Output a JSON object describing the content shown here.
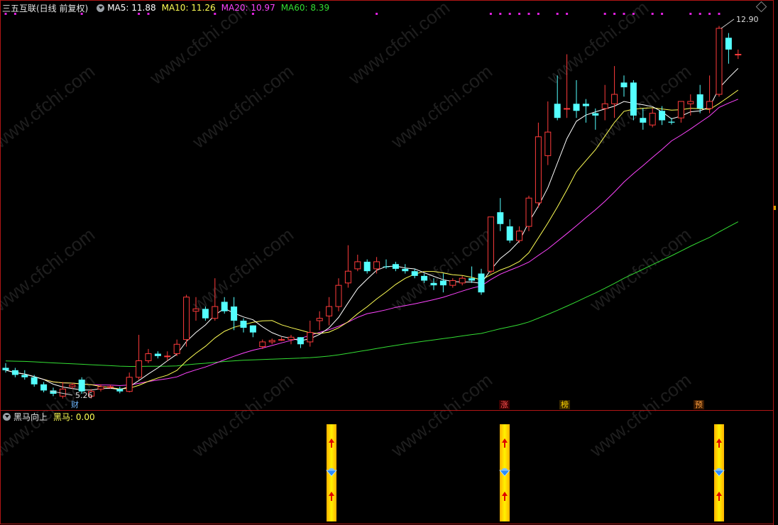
{
  "main_legend": {
    "title": "三五互联(日线 前复权)",
    "ma5": "MA5: 11.88",
    "ma10": "MA10: 11.26",
    "ma20": "MA20: 10.97",
    "ma60": "MA60: 8.39"
  },
  "sub_legend": {
    "title": "黑马向上",
    "value": "黑马: 0.00"
  },
  "labels": {
    "high": "12.90",
    "low": "5.26",
    "cai": "财",
    "zhang": "涨",
    "bang": "榜",
    "yu": "预"
  },
  "colors": {
    "bg": "#000000",
    "up": "#ff3b3b",
    "down": "#54ffff",
    "ma5": "#ffffff",
    "ma10": "#ffff55",
    "ma20": "#ff44ff",
    "ma60": "#33dd33",
    "frame": "#b01515",
    "signal": "#ffd400"
  },
  "chart_data": {
    "type": "candlestick",
    "title": "三五互联(日线 前复权)",
    "series": [
      {
        "name": "MA5",
        "last": 11.88
      },
      {
        "name": "MA10",
        "last": 11.26
      },
      {
        "name": "MA20",
        "last": 10.97
      },
      {
        "name": "MA60",
        "last": 8.39
      }
    ],
    "ylim": [
      5.0,
      13.2
    ],
    "high_mark": 12.9,
    "low_mark": 5.26,
    "candles": [
      [
        5.7,
        5.65,
        5.8,
        5.6
      ],
      [
        5.65,
        5.55,
        5.7,
        5.5
      ],
      [
        5.55,
        5.5,
        5.65,
        5.45
      ],
      [
        5.5,
        5.35,
        5.55,
        5.3
      ],
      [
        5.35,
        5.22,
        5.4,
        5.18
      ],
      [
        5.22,
        5.15,
        5.28,
        5.1
      ],
      [
        5.1,
        5.25,
        5.4,
        5.05
      ],
      [
        5.3,
        5.34,
        5.38,
        5.25
      ],
      [
        5.45,
        5.2,
        5.5,
        5.15
      ],
      [
        5.1,
        5.2,
        5.25,
        5.05
      ],
      [
        5.25,
        5.3,
        5.35,
        5.2
      ],
      [
        5.3,
        5.3,
        5.34,
        5.26
      ],
      [
        5.25,
        5.2,
        5.3,
        5.16
      ],
      [
        5.2,
        5.5,
        5.6,
        5.18
      ],
      [
        5.5,
        5.85,
        6.4,
        5.45
      ],
      [
        5.85,
        6.0,
        6.1,
        5.8
      ],
      [
        6.0,
        5.95,
        6.05,
        5.9
      ],
      [
        5.95,
        5.95,
        6.05,
        5.85
      ],
      [
        6.0,
        6.2,
        6.3,
        5.95
      ],
      [
        6.3,
        7.2,
        7.25,
        6.15
      ],
      [
        6.9,
        6.95,
        7.2,
        6.7
      ],
      [
        6.95,
        6.75,
        7.0,
        6.7
      ],
      [
        6.75,
        7.0,
        7.6,
        6.7
      ],
      [
        7.1,
        6.9,
        7.2,
        6.85
      ],
      [
        7.0,
        6.7,
        7.2,
        6.5
      ],
      [
        6.7,
        6.55,
        6.75,
        6.45
      ],
      [
        6.6,
        6.45,
        6.6,
        6.35
      ],
      [
        6.15,
        6.25,
        6.3,
        6.1
      ],
      [
        6.25,
        6.28,
        6.32,
        6.2
      ],
      [
        6.3,
        6.3,
        6.35,
        6.27
      ],
      [
        6.3,
        6.35,
        6.4,
        6.2
      ],
      [
        6.35,
        6.2,
        6.35,
        6.12
      ],
      [
        6.25,
        6.45,
        6.7,
        6.15
      ],
      [
        6.7,
        6.75,
        6.9,
        6.5
      ],
      [
        6.8,
        7.0,
        7.2,
        6.6
      ],
      [
        7.0,
        7.45,
        7.6,
        6.9
      ],
      [
        7.5,
        7.75,
        8.3,
        7.4
      ],
      [
        7.8,
        7.95,
        8.1,
        7.75
      ],
      [
        7.95,
        7.75,
        8.0,
        7.7
      ],
      [
        7.8,
        7.95,
        8.05,
        7.7
      ],
      [
        7.85,
        7.84,
        8.0,
        7.8
      ],
      [
        7.9,
        7.8,
        7.95,
        7.75
      ],
      [
        7.8,
        7.75,
        7.9,
        7.7
      ],
      [
        7.75,
        7.65,
        7.8,
        7.6
      ],
      [
        7.65,
        7.55,
        7.7,
        7.5
      ],
      [
        7.5,
        7.45,
        7.6,
        7.35
      ],
      [
        7.55,
        7.45,
        7.7,
        7.3
      ],
      [
        7.45,
        7.55,
        7.6,
        7.4
      ],
      [
        7.5,
        7.6,
        7.65,
        7.45
      ],
      [
        7.6,
        7.55,
        7.85,
        7.5
      ],
      [
        7.7,
        7.3,
        7.8,
        7.25
      ],
      [
        7.75,
        8.9,
        8.9,
        7.7
      ],
      [
        9.0,
        8.75,
        9.3,
        8.6
      ],
      [
        8.7,
        8.4,
        8.85,
        8.35
      ],
      [
        8.4,
        8.6,
        8.7,
        8.35
      ],
      [
        8.7,
        9.3,
        9.35,
        8.6
      ],
      [
        9.2,
        10.6,
        10.9,
        9.1
      ],
      [
        10.2,
        10.7,
        11.35,
        10.0
      ],
      [
        11.3,
        11.0,
        11.9,
        10.95
      ],
      [
        11.2,
        11.2,
        12.35,
        11.0
      ],
      [
        11.3,
        11.15,
        11.8,
        11.0
      ],
      [
        11.3,
        11.25,
        11.4,
        10.9
      ],
      [
        11.1,
        11.05,
        11.2,
        10.75
      ],
      [
        11.2,
        11.3,
        11.7,
        10.95
      ],
      [
        11.3,
        11.5,
        12.1,
        11.0
      ],
      [
        11.75,
        11.65,
        11.9,
        11.45
      ],
      [
        11.75,
        11.05,
        11.8,
        10.95
      ],
      [
        11.0,
        10.9,
        11.2,
        10.75
      ],
      [
        10.85,
        11.1,
        11.2,
        10.8
      ],
      [
        11.15,
        10.95,
        11.25,
        10.85
      ],
      [
        10.92,
        10.9,
        11.0,
        10.86
      ],
      [
        11.0,
        11.35,
        11.35,
        10.9
      ],
      [
        11.3,
        11.35,
        11.5,
        11.05
      ],
      [
        11.5,
        11.2,
        11.7,
        11.1
      ],
      [
        11.2,
        11.35,
        11.9,
        11.1
      ],
      [
        11.5,
        12.9,
        12.95,
        11.45
      ],
      [
        12.7,
        12.45,
        12.8,
        12.15
      ],
      [
        12.35,
        12.35,
        12.45,
        12.25
      ]
    ]
  }
}
